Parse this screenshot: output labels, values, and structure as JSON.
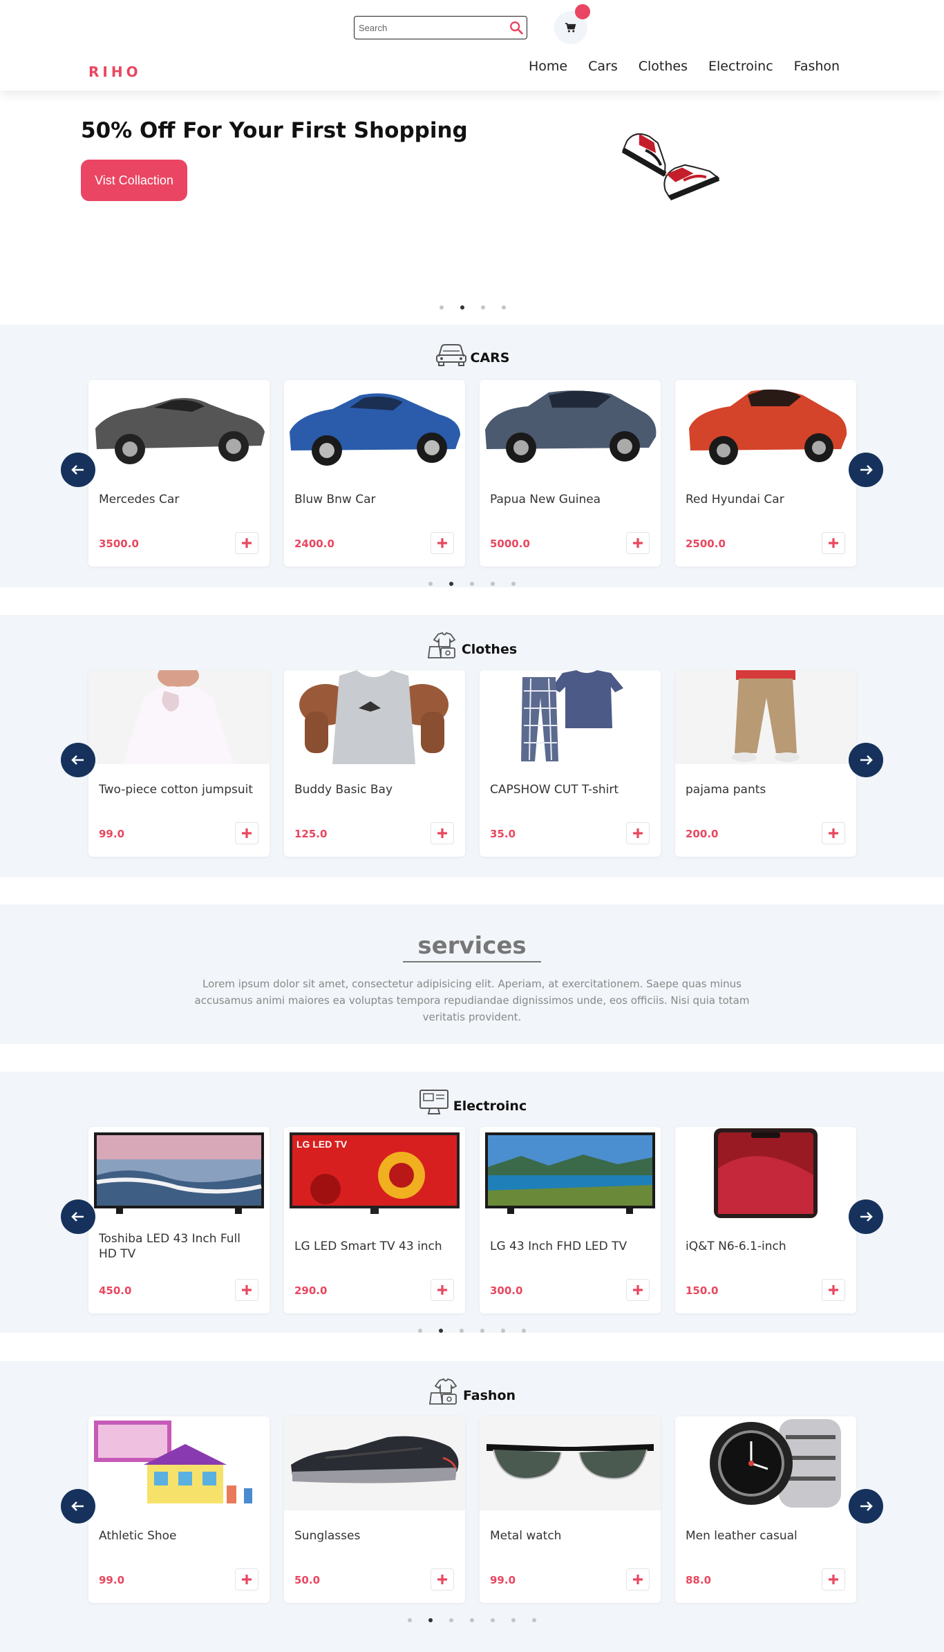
{
  "header": {
    "search_placeholder": "Search",
    "logo": "RIHO",
    "nav": [
      "Home",
      "Cars",
      "Clothes",
      "Electroinc",
      "Fashon"
    ]
  },
  "hero": {
    "title": "50% Off For Your First Shopping",
    "button": "Vist Collaction",
    "slide_count": 4,
    "active_slide": 1
  },
  "sections": [
    {
      "title": "CARS",
      "icon": "car-icon",
      "products": [
        {
          "name": "Mercedes Car",
          "price": "3500.0",
          "image": "car-gray-icon"
        },
        {
          "name": "Bluw Bnw Car",
          "price": "2400.0",
          "image": "car-blue-icon"
        },
        {
          "name": "Papua New Guinea",
          "price": "5000.0",
          "image": "car-slate-icon"
        },
        {
          "name": "Red Hyundai Car",
          "price": "2500.0",
          "image": "car-red-icon"
        }
      ],
      "dots": 5,
      "active_dot": 1
    },
    {
      "title": "Clothes",
      "icon": "clothes-icon",
      "products": [
        {
          "name": "Two-piece cotton jumpsuit",
          "price": "99.0",
          "image": "white-top-icon"
        },
        {
          "name": "Buddy Basic Bay",
          "price": "125.0",
          "image": "tank-top-icon"
        },
        {
          "name": "CAPSHOW CUT T-shirt",
          "price": "35.0",
          "image": "pajama-set-icon"
        },
        {
          "name": "pajama pants",
          "price": "200.0",
          "image": "khaki-pants-icon"
        }
      ],
      "dots": 0,
      "active_dot": 0
    },
    {
      "title": "Electroinc",
      "icon": "monitor-icon",
      "products": [
        {
          "name": "Toshiba LED 43 Inch Full HD TV",
          "price": "450.0",
          "image": "tv-wave-icon"
        },
        {
          "name": "LG LED Smart TV 43 inch",
          "price": "290.0",
          "image": "tv-red-icon"
        },
        {
          "name": "LG 43 Inch FHD LED TV",
          "price": "300.0",
          "image": "tv-lake-icon"
        },
        {
          "name": "iQ&T N6-6.1-inch",
          "price": "150.0",
          "image": "phone-icon"
        }
      ],
      "tv_badge": "LG LED TV",
      "dots": 6,
      "active_dot": 1
    },
    {
      "title": "Fashon",
      "icon": "clothes-icon",
      "products": [
        {
          "name": "Athletic Shoe",
          "price": "99.0",
          "image": "toy-house-icon"
        },
        {
          "name": "Sunglasses",
          "price": "50.0",
          "image": "sneaker-icon"
        },
        {
          "name": "Metal watch",
          "price": "99.0",
          "image": "sunglasses-icon"
        },
        {
          "name": "Men leather casual",
          "price": "88.0",
          "image": "watch-icon"
        }
      ],
      "dots": 7,
      "active_dot": 1
    }
  ],
  "services": {
    "title": "services",
    "text": "Lorem ipsum dolor sit amet, consectetur adipisicing elit. Aperiam, at exercitationem. Saepe quas minus accusamus animi maiores ea voluptas tempora repudiandae dignissimos unde, eos officiis. Nisi quia totam veritatis provident."
  },
  "colors": {
    "accent": "#ea4563",
    "navy": "#16325c",
    "section_bg": "#f2f5f9"
  }
}
